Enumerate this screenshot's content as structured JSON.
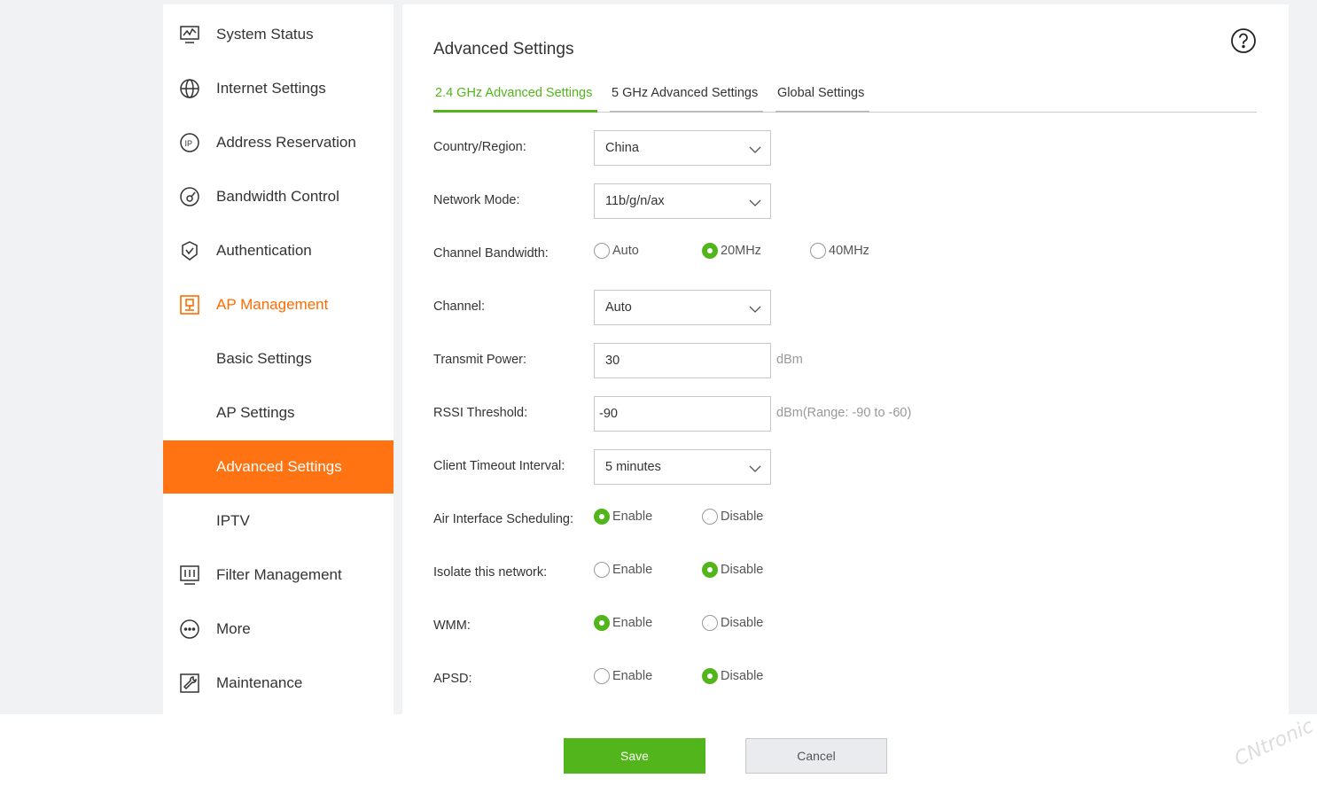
{
  "sidebar": {
    "items": [
      {
        "label": "System Status",
        "icon": "monitor-chart-icon"
      },
      {
        "label": "Internet Settings",
        "icon": "globe-icon"
      },
      {
        "label": "Address Reservation",
        "icon": "ip-icon"
      },
      {
        "label": "Bandwidth Control",
        "icon": "gauge-icon"
      },
      {
        "label": "Authentication",
        "icon": "shield-check-icon"
      },
      {
        "label": "AP Management",
        "icon": "ap-icon"
      },
      {
        "label": "Basic Settings"
      },
      {
        "label": "AP Settings"
      },
      {
        "label": "Advanced Settings"
      },
      {
        "label": "IPTV"
      },
      {
        "label": "Filter Management",
        "icon": "filter-monitor-icon"
      },
      {
        "label": "More",
        "icon": "more-dots-icon"
      },
      {
        "label": "Maintenance",
        "icon": "wrench-icon"
      }
    ]
  },
  "main": {
    "title": "Advanced Settings",
    "tabs": [
      {
        "label": "2.4 GHz Advanced Settings"
      },
      {
        "label": "5 GHz Advanced Settings"
      },
      {
        "label": "Global Settings"
      }
    ],
    "fields": {
      "country": {
        "label": "Country/Region:",
        "value": "China"
      },
      "network_mode": {
        "label": "Network Mode:",
        "value": "11b/g/n/ax"
      },
      "channel_bandwidth": {
        "label": "Channel Bandwidth:",
        "options": [
          "Auto",
          "20MHz",
          "40MHz"
        ],
        "selected": "20MHz"
      },
      "channel": {
        "label": "Channel:",
        "value": "Auto"
      },
      "transmit_power": {
        "label": "Transmit Power:",
        "value": "30",
        "unit": "dBm"
      },
      "rssi_threshold": {
        "label": "RSSI Threshold:",
        "value": "-90",
        "unit": "dBm(Range: -90 to -60)"
      },
      "client_timeout": {
        "label": "Client Timeout Interval:",
        "value": "5 minutes"
      },
      "air_interface": {
        "label": "Air Interface Scheduling:",
        "options": [
          "Enable",
          "Disable"
        ],
        "selected": "Enable"
      },
      "isolate": {
        "label": "Isolate this network:",
        "options": [
          "Enable",
          "Disable"
        ],
        "selected": "Disable"
      },
      "wmm": {
        "label": "WMM:",
        "options": [
          "Enable",
          "Disable"
        ],
        "selected": "Enable"
      },
      "apsd": {
        "label": "APSD:",
        "options": [
          "Enable",
          "Disable"
        ],
        "selected": "Disable"
      }
    }
  },
  "footer": {
    "save": "Save",
    "cancel": "Cancel"
  },
  "watermark": "CNtronic",
  "colors": {
    "accent_orange": "#ff7312",
    "accent_green": "#52b51b"
  }
}
